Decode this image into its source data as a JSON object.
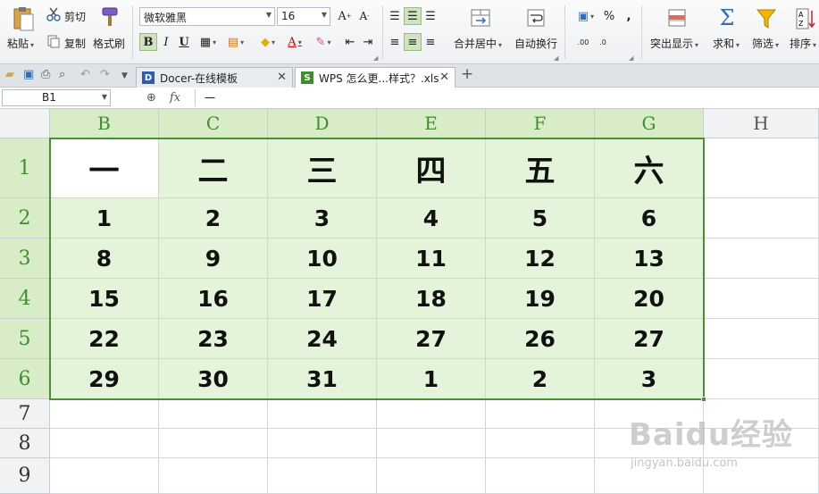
{
  "ribbon": {
    "paste": "粘贴",
    "cut": "剪切",
    "copy": "复制",
    "format_painter": "格式刷",
    "font_name": "微软雅黑",
    "font_size": "16",
    "bold": "B",
    "italic": "I",
    "underline": "U",
    "merge_center": "合并居中",
    "wrap_text": "自动换行",
    "percent": "%",
    "comma": ",",
    "highlight": "突出显示",
    "sum": "求和",
    "filter": "筛选",
    "sort": "排序"
  },
  "tabs": [
    {
      "label": "Docer-在线模板",
      "active": false
    },
    {
      "label": "WPS 怎么更...样式？.xls",
      "active": true
    }
  ],
  "formula_bar": {
    "name_box": "B1",
    "fx": "fx",
    "content": "一"
  },
  "sheet": {
    "columns": [
      "B",
      "C",
      "D",
      "E",
      "F",
      "G",
      "H"
    ],
    "rows": [
      "1",
      "2",
      "3",
      "4",
      "5",
      "6",
      "7",
      "8",
      "9"
    ],
    "cells": [
      [
        "一",
        "二",
        "三",
        "四",
        "五",
        "六"
      ],
      [
        "1",
        "2",
        "3",
        "4",
        "5",
        "6"
      ],
      [
        "8",
        "9",
        "10",
        "11",
        "12",
        "13"
      ],
      [
        "15",
        "16",
        "17",
        "18",
        "19",
        "20"
      ],
      [
        "22",
        "23",
        "24",
        "27",
        "26",
        "27"
      ],
      [
        "29",
        "30",
        "31",
        "1",
        "2",
        "3"
      ]
    ]
  },
  "watermark": {
    "logo": "Baidu经验",
    "url": "jingyan.baidu.com"
  },
  "colors": {
    "selection_header_bg": "#d8ecc8",
    "selection_fill": "#e3f4da",
    "selection_border": "#4a8f33",
    "header_text_green": "#3d8f2b"
  }
}
